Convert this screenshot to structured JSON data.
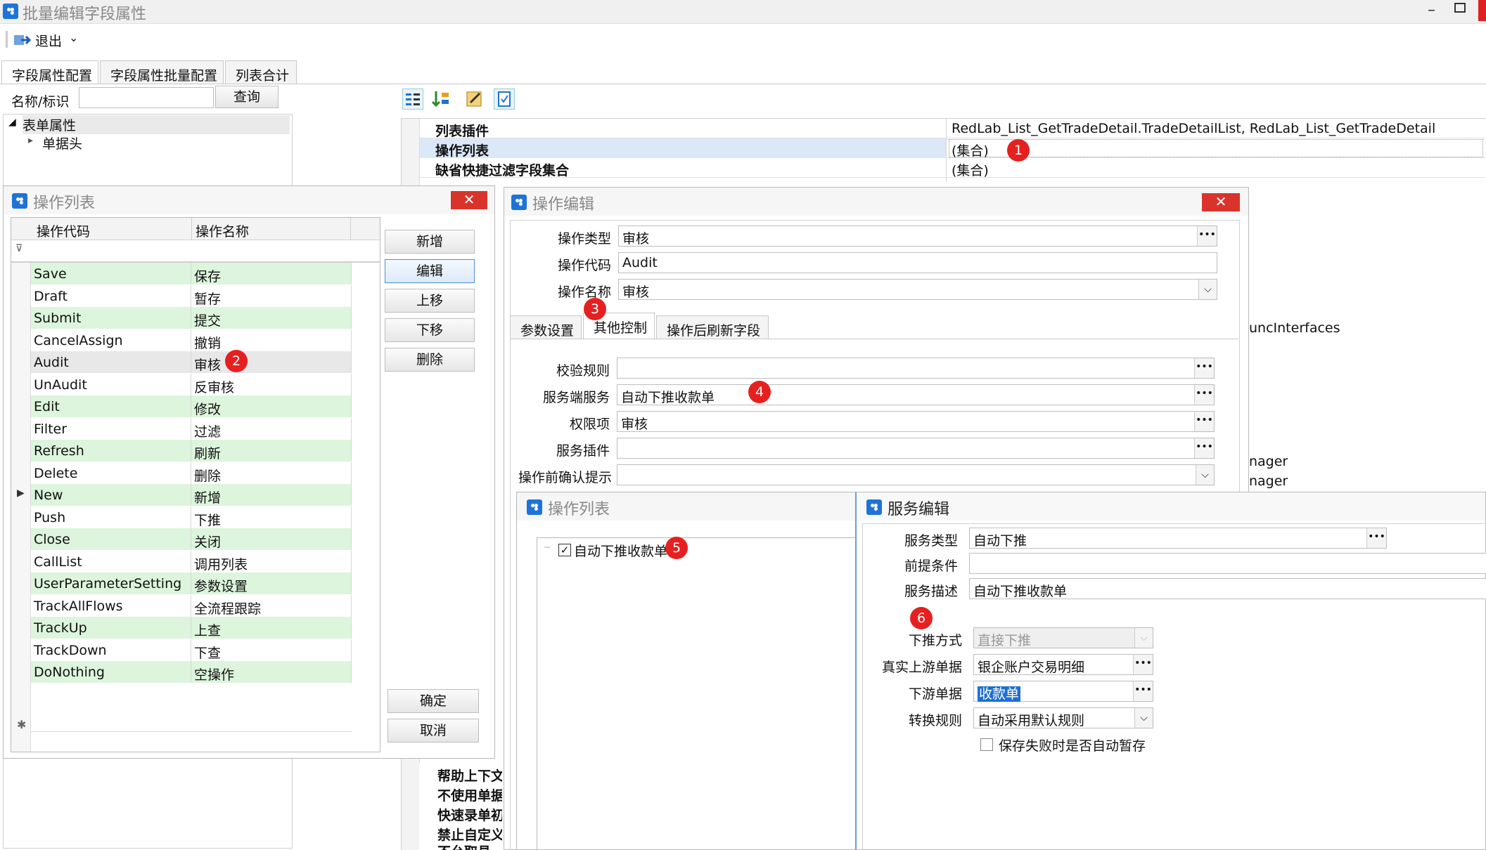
{
  "window": {
    "title": "批量编辑字段属性"
  },
  "toolbar": {
    "exit_label": "退出",
    "exit_caret": "⌄"
  },
  "main_tabs": [
    "字段属性配置",
    "字段属性批量配置",
    "列表合计"
  ],
  "search": {
    "label": "名称/标识",
    "value": "",
    "button": "查询"
  },
  "tree": {
    "root": "表单属性",
    "child": "单据头"
  },
  "properties": [
    {
      "name": "列表插件",
      "value": "RedLab_List_GetTradeDetail.TradeDetailList, RedLab_List_GetTradeDetail"
    },
    {
      "name": "操作列表",
      "value": "(集合)"
    },
    {
      "name": "缺省快捷过滤字段集合",
      "value": "(集合)"
    }
  ],
  "bg_fragments": {
    "right1": "uncInterfaces",
    "right2": "nager",
    "right3": "nager",
    "bottom": [
      "帮助上下文",
      "不使用单据",
      "快速录单初",
      "禁止自定义",
      "不允取县"
    ]
  },
  "op_list_dialog": {
    "title": "操作列表",
    "col_code": "操作代码",
    "col_name": "操作名称",
    "rows": [
      {
        "code": "Save",
        "name": "保存"
      },
      {
        "code": "Draft",
        "name": "暂存"
      },
      {
        "code": "Submit",
        "name": "提交"
      },
      {
        "code": "CancelAssign",
        "name": "撤销"
      },
      {
        "code": "Audit",
        "name": "审核"
      },
      {
        "code": "UnAudit",
        "name": "反审核"
      },
      {
        "code": "Edit",
        "name": "修改"
      },
      {
        "code": "Filter",
        "name": "过滤"
      },
      {
        "code": "Refresh",
        "name": "刷新"
      },
      {
        "code": "Delete",
        "name": "删除"
      },
      {
        "code": "New",
        "name": "新增"
      },
      {
        "code": "Push",
        "name": "下推"
      },
      {
        "code": "Close",
        "name": "关闭"
      },
      {
        "code": "CallList",
        "name": "调用列表"
      },
      {
        "code": "UserParameterSetting",
        "name": "参数设置"
      },
      {
        "code": "TrackAllFlows",
        "name": "全流程跟踪"
      },
      {
        "code": "TrackUp",
        "name": "上查"
      },
      {
        "code": "TrackDown",
        "name": "下查"
      },
      {
        "code": "DoNothing",
        "name": "空操作"
      }
    ],
    "buttons": {
      "add": "新增",
      "edit": "编辑",
      "up": "上移",
      "down": "下移",
      "delete": "删除",
      "ok": "确定",
      "cancel": "取消"
    }
  },
  "op_edit_dialog": {
    "title": "操作编辑",
    "fields": {
      "type_label": "操作类型",
      "type_value": "审核",
      "code_label": "操作代码",
      "code_value": "Audit",
      "name_label": "操作名称",
      "name_value": "审核"
    },
    "tabs": [
      "参数设置",
      "其他控制",
      "操作后刷新字段"
    ],
    "other": {
      "rule_label": "校验规则",
      "rule_value": "",
      "service_label": "服务端服务",
      "service_value": "自动下推收款单",
      "perm_label": "权限项",
      "perm_value": "审核",
      "plugin_label": "服务插件",
      "plugin_value": "",
      "confirm_label": "操作前确认提示",
      "confirm_value": ""
    }
  },
  "op_list2_dialog": {
    "title": "操作列表",
    "item": "自动下推收款单"
  },
  "service_edit_dialog": {
    "title": "服务编辑",
    "type_label": "服务类型",
    "type_value": "自动下推",
    "cond_label": "前提条件",
    "cond_value": "",
    "desc_label": "服务描述",
    "desc_value": "自动下推收款单",
    "push_label": "下推方式",
    "push_value": "直接下推",
    "up_label": "真实上游单据",
    "up_value": "银企账户交易明细",
    "down_label": "下游单据",
    "down_value": "收款单",
    "rule_label": "转换规则",
    "rule_value": "自动采用默认规则",
    "checkbox_label": "保存失败时是否自动暂存"
  },
  "badges": [
    "1",
    "2",
    "3",
    "4",
    "5",
    "6"
  ],
  "colors": {
    "row_green": "#dcf5dc",
    "badge_red": "#e62020",
    "close_red": "#d9342b",
    "accent_blue": "#1e73d8",
    "selected_row": "#dbe8f8"
  }
}
